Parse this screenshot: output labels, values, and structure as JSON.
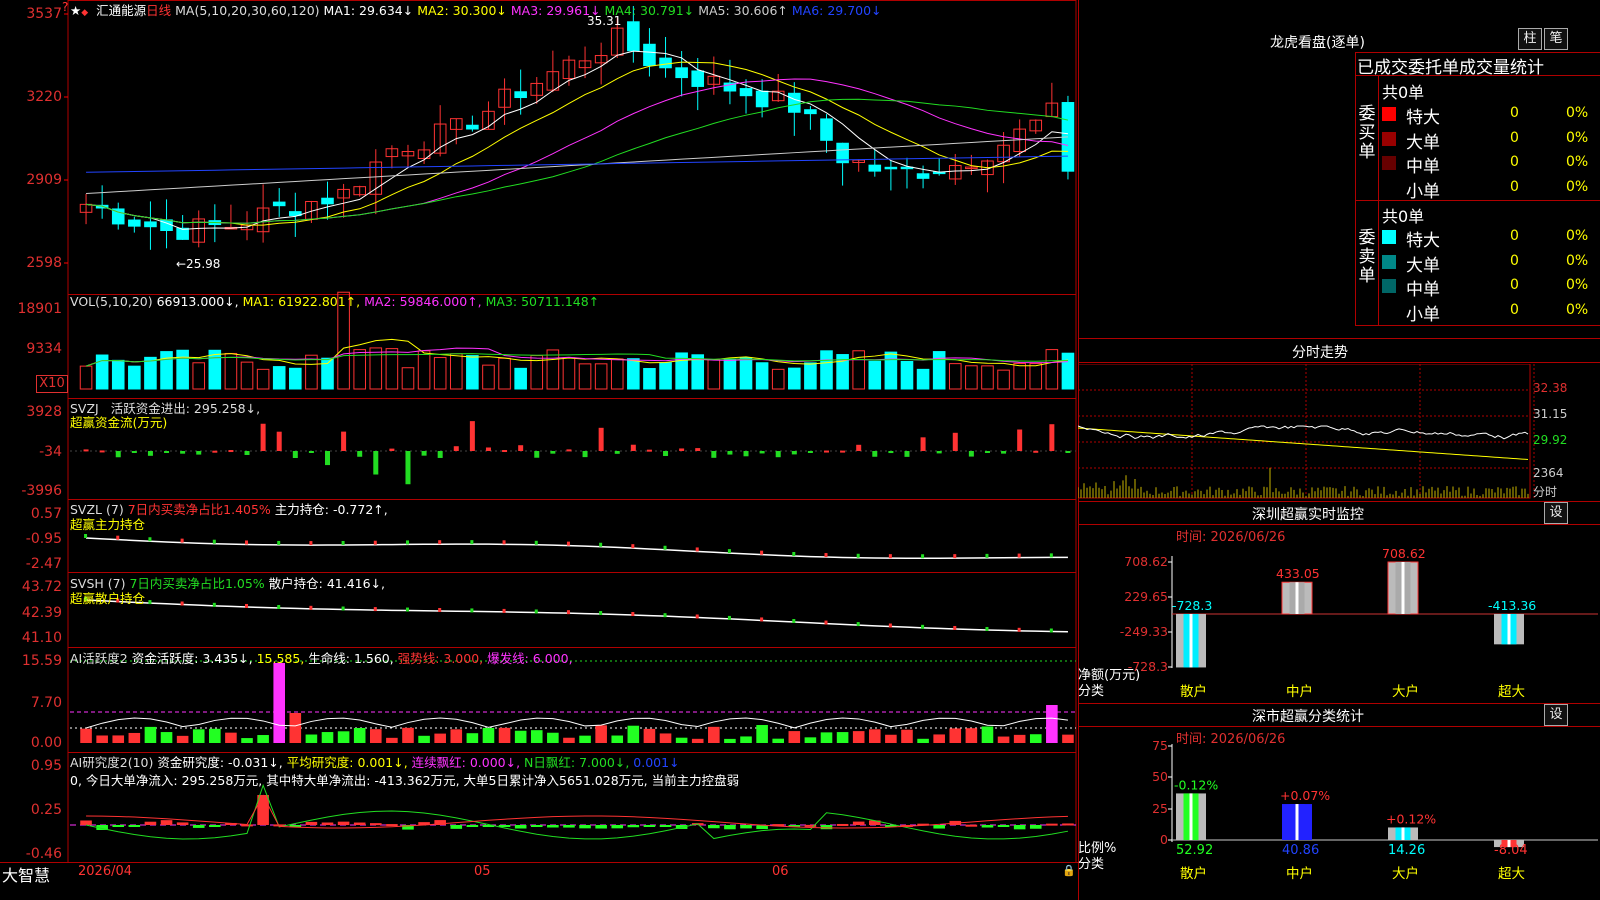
{
  "stock": {
    "name": "汇通能源",
    "period": "日线"
  },
  "main_panel": {
    "ma_params": "MA(5,10,20,30,60,120)",
    "ma": [
      {
        "label": "MA1:",
        "value": "29.634",
        "arrow": "↓",
        "color": "#ffffff"
      },
      {
        "label": "MA2:",
        "value": "30.300",
        "arrow": "↓",
        "color": "#ffff00"
      },
      {
        "label": "MA3:",
        "value": "29.961",
        "arrow": "↓",
        "color": "#ff33ff"
      },
      {
        "label": "MA4:",
        "value": "30.791",
        "arrow": "↓",
        "color": "#22dd22"
      },
      {
        "label": "MA5:",
        "value": "30.606",
        "arrow": "↑",
        "color": "#cccccc"
      },
      {
        "label": "MA6:",
        "value": "29.700",
        "arrow": "↓",
        "color": "#2244ff"
      }
    ],
    "y_ticks": [
      "3537",
      "3220",
      "2909",
      "2598"
    ],
    "high_mark": "35.31",
    "low_mark": "←25.98"
  },
  "vol_panel": {
    "params": "VOL(5,10,20)",
    "value": "66913.000↓,",
    "ma": [
      {
        "label": "MA1:",
        "value": "61922.801↑,",
        "color": "#ffff00"
      },
      {
        "label": "MA2:",
        "value": "59846.000↑,",
        "color": "#ff33ff"
      },
      {
        "label": "MA3:",
        "value": "50711.148↑",
        "color": "#22dd22"
      }
    ],
    "y_ticks": [
      "18901",
      "9334"
    ],
    "unit_badge": "X10"
  },
  "svzj_panel": {
    "name": "SVZJ",
    "label": "活跃资金进出: 295.258↓,",
    "sublabel": "超赢资金流(万元)",
    "y_ticks": [
      "3928",
      "-34",
      "-3996"
    ]
  },
  "svzl_panel": {
    "name": "SVZL (7)",
    "text1": "7日内买卖净占比1.405%",
    "text2": "主力持仓: -0.772↑,",
    "sublabel": "超赢主力持仓",
    "y_ticks": [
      "0.57",
      "-0.95",
      "-2.47"
    ]
  },
  "svsh_panel": {
    "name": "SVSH (7)",
    "text1": "7日内买卖净占比1.05%",
    "text2": "散户持仓: 41.416↓,",
    "sublabel": "超赢散户持仓",
    "y_ticks": [
      "43.72",
      "42.39",
      "41.10"
    ]
  },
  "ai_active_panel": {
    "name": "AI活跃度2",
    "items": [
      {
        "text": "资金活跃度: 3.435↓,",
        "color": "#ffffff"
      },
      {
        "text": "15.585,",
        "color": "#ffff00"
      },
      {
        "text": "生命线: 1.560,",
        "color": "#ffffff"
      },
      {
        "text": "强势线: 3.000,",
        "color": "#ff3333"
      },
      {
        "text": "爆发线: 6.000,",
        "color": "#ff33ff"
      }
    ],
    "y_ticks": [
      "15.59",
      "7.70",
      "0.00"
    ]
  },
  "ai_research_panel": {
    "name": "AI研究度2(10)",
    "items": [
      {
        "text": "资金研究度: -0.031↓,",
        "color": "#ffffff"
      },
      {
        "text": "平均研究度: 0.001↓,",
        "color": "#ffff00"
      },
      {
        "text": "连续飘红: 0.000↓,",
        "color": "#ff33ff"
      },
      {
        "text": "N日飘红: 7.000↓,",
        "color": "#22dd22"
      },
      {
        "text": "0.001↓",
        "color": "#2244ff"
      }
    ],
    "comment": "0, 今日大单净流入: 295.258万元, 其中特大单净流出: -413.362万元, 大单5日累计净入5651.028万元, 当前主力控盘弱",
    "y_ticks": [
      "0.95",
      "0.25",
      "-0.46"
    ]
  },
  "bottom_bar": {
    "brand": "大智慧",
    "date_start": "2026/04",
    "month_05": "05",
    "month_06": "06"
  },
  "right_panel": {
    "dragon_title": "龙虎看盘(逐单)",
    "btn_bar": "柱",
    "btn_pen": "笔",
    "header": "已成交委托单成交量统计",
    "buy": {
      "side": "委买单",
      "total": "共0单",
      "rows": [
        {
          "label": "特大",
          "count": "0",
          "pct": "0%",
          "color": "#ff0000"
        },
        {
          "label": "大单",
          "count": "0",
          "pct": "0%",
          "color": "#990000"
        },
        {
          "label": "中单",
          "count": "0",
          "pct": "0%",
          "color": "#660000"
        },
        {
          "label": "小单",
          "count": "0",
          "pct": "0%",
          "color": ""
        }
      ]
    },
    "sell": {
      "side": "委卖单",
      "total": "共0单",
      "rows": [
        {
          "label": "特大",
          "count": "0",
          "pct": "0%",
          "color": "#00ffff"
        },
        {
          "label": "大单",
          "count": "0",
          "pct": "0%",
          "color": "#008888"
        },
        {
          "label": "中单",
          "count": "0",
          "pct": "0%",
          "color": "#006666"
        },
        {
          "label": "小单",
          "count": "0",
          "pct": "0%",
          "color": ""
        }
      ]
    },
    "intraday": {
      "title": "分时走势",
      "y_ticks": [
        "32.38",
        "31.15",
        "29.92",
        "2364",
        "分时"
      ]
    },
    "sz_monitor": {
      "title": "深圳超赢实时监控",
      "settings": "设",
      "time": "时间: 2026/06/26",
      "y_ticks": [
        "708.62",
        "229.65",
        "-249.33",
        "-728.3"
      ],
      "ylabel": "净额(万元)",
      "xlabel": "分类",
      "categories": [
        "散户",
        "中户",
        "大户",
        "超大"
      ],
      "values": [
        -728.3,
        433.05,
        708.62,
        -413.36
      ],
      "value_labels": [
        "-728.3",
        "433.05",
        "708.62",
        "-413.36"
      ]
    },
    "sz_class": {
      "title": "深市超赢分类统计",
      "settings": "设",
      "time": "时间: 2026/06/26",
      "y_ticks": [
        "75",
        "50",
        "25",
        "0"
      ],
      "ylabel": "比例%",
      "xlabel": "分类",
      "categories": [
        "散户",
        "中户",
        "大户",
        "超大"
      ],
      "values": [
        52.92,
        40.86,
        14.26,
        -8.04
      ],
      "value_labels": [
        "52.92",
        "40.86",
        "14.26",
        "-8.04"
      ],
      "change_labels": [
        "-0.12%",
        "+0.07%",
        "+0.12%",
        ""
      ]
    }
  },
  "colors": {
    "up": "#ff3333",
    "down": "#00ffff",
    "axis": "#e03030",
    "grid": "#b00000"
  }
}
